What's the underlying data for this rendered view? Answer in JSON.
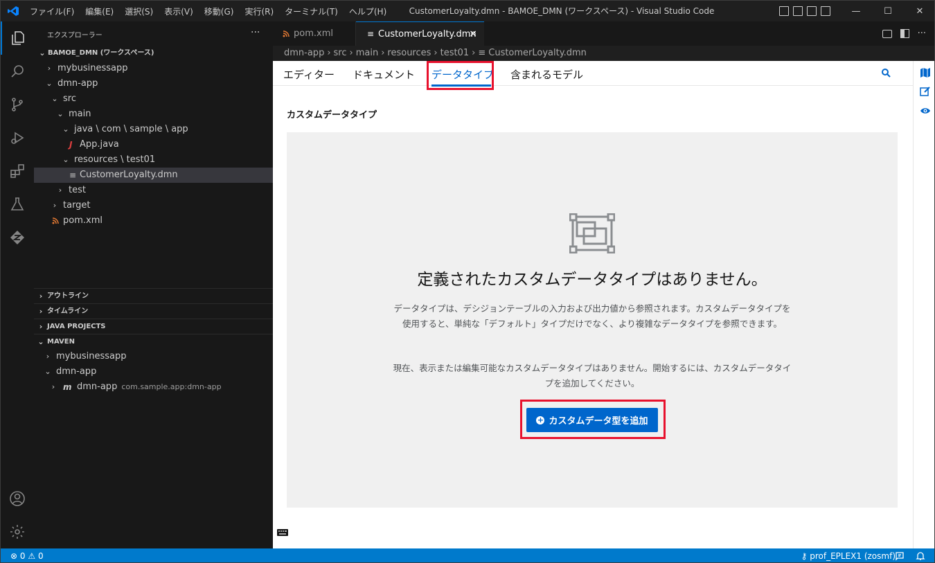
{
  "window": {
    "title": "CustomerLoyalty.dmn - BAMOE_DMN (ワークスペース) - Visual Studio Code",
    "menu": [
      "ファイル(F)",
      "編集(E)",
      "選択(S)",
      "表示(V)",
      "移動(G)",
      "実行(R)",
      "ターミナル(T)",
      "ヘルプ(H)"
    ],
    "controls": {
      "minimize": "—",
      "maximize": "☐",
      "close": "✕"
    }
  },
  "activity_bar": [
    "explorer-icon",
    "search-icon",
    "source-control-icon",
    "run-debug-icon",
    "extensions-icon",
    "testing-icon",
    "zowe-icon",
    "account-icon",
    "settings-gear-icon"
  ],
  "explorer": {
    "title": "エクスプローラー",
    "more": "···",
    "workspace": "BAMOE_DMN (ワークスペース)",
    "tree": [
      {
        "label": "mybusinessapp",
        "chevron": "›"
      },
      {
        "label": "dmn-app",
        "chevron": "⌄"
      },
      {
        "label": "src",
        "chevron": "⌄"
      },
      {
        "label": "main",
        "chevron": "⌄"
      },
      {
        "label": "java \\ com \\ sample \\ app",
        "chevron": "⌄"
      },
      {
        "label": "App.java",
        "icon": "J"
      },
      {
        "label": "resources \\ test01",
        "chevron": "⌄"
      },
      {
        "label": "CustomerLoyalty.dmn",
        "icon": "≡"
      },
      {
        "label": "test",
        "chevron": "›"
      },
      {
        "label": "target",
        "chevron": "›"
      },
      {
        "label": "pom.xml",
        "icon": "rss"
      }
    ],
    "sections": [
      "アウトライン",
      "タイムライン",
      "JAVA PROJECTS",
      "MAVEN"
    ],
    "maven": [
      {
        "label": "mybusinessapp",
        "chevron": "›"
      },
      {
        "label": "dmn-app",
        "chevron": "⌄"
      },
      {
        "label": "dmn-app",
        "sub": "com.sample.app:dmn-app",
        "chevron": "›",
        "icon": "m"
      }
    ]
  },
  "tabs": [
    {
      "label": "pom.xml",
      "active": false
    },
    {
      "label": "CustomerLoyalty.dmn",
      "active": true,
      "close": "×"
    }
  ],
  "breadcrumb": [
    "dmn-app",
    "src",
    "main",
    "resources",
    "test01",
    "CustomerLoyalty.dmn"
  ],
  "dmn_editor": {
    "tabs": [
      "エディター",
      "ドキュメント",
      "データタイプ",
      "含まれるモデル"
    ],
    "active_tab": "データタイプ",
    "section_title": "カスタムデータタイプ",
    "empty_title": "定義されたカスタムデータタイプはありません。",
    "empty_body_1": "データタイプは、デシジョンテーブルの入力および出力値から参照されます。カスタムデータタイプを使用すると、単純な「デフォルト」タイプだけでなく、より複雑なデータタイプを参照できます。",
    "empty_body_2": "現在、表示または編集可能なカスタムデータタイプはありません。開始するには、カスタムデータタイプを追加してください。",
    "add_button": "カスタムデータ型を追加"
  },
  "statusbar": {
    "errors": "0",
    "warnings": "0",
    "profile": "prof_EPLEX1 (zosmf)"
  },
  "colors": {
    "accent": "#0078d4",
    "status": "#007acc",
    "pf_blue": "#0066cc",
    "highlight": "#e8112d"
  }
}
